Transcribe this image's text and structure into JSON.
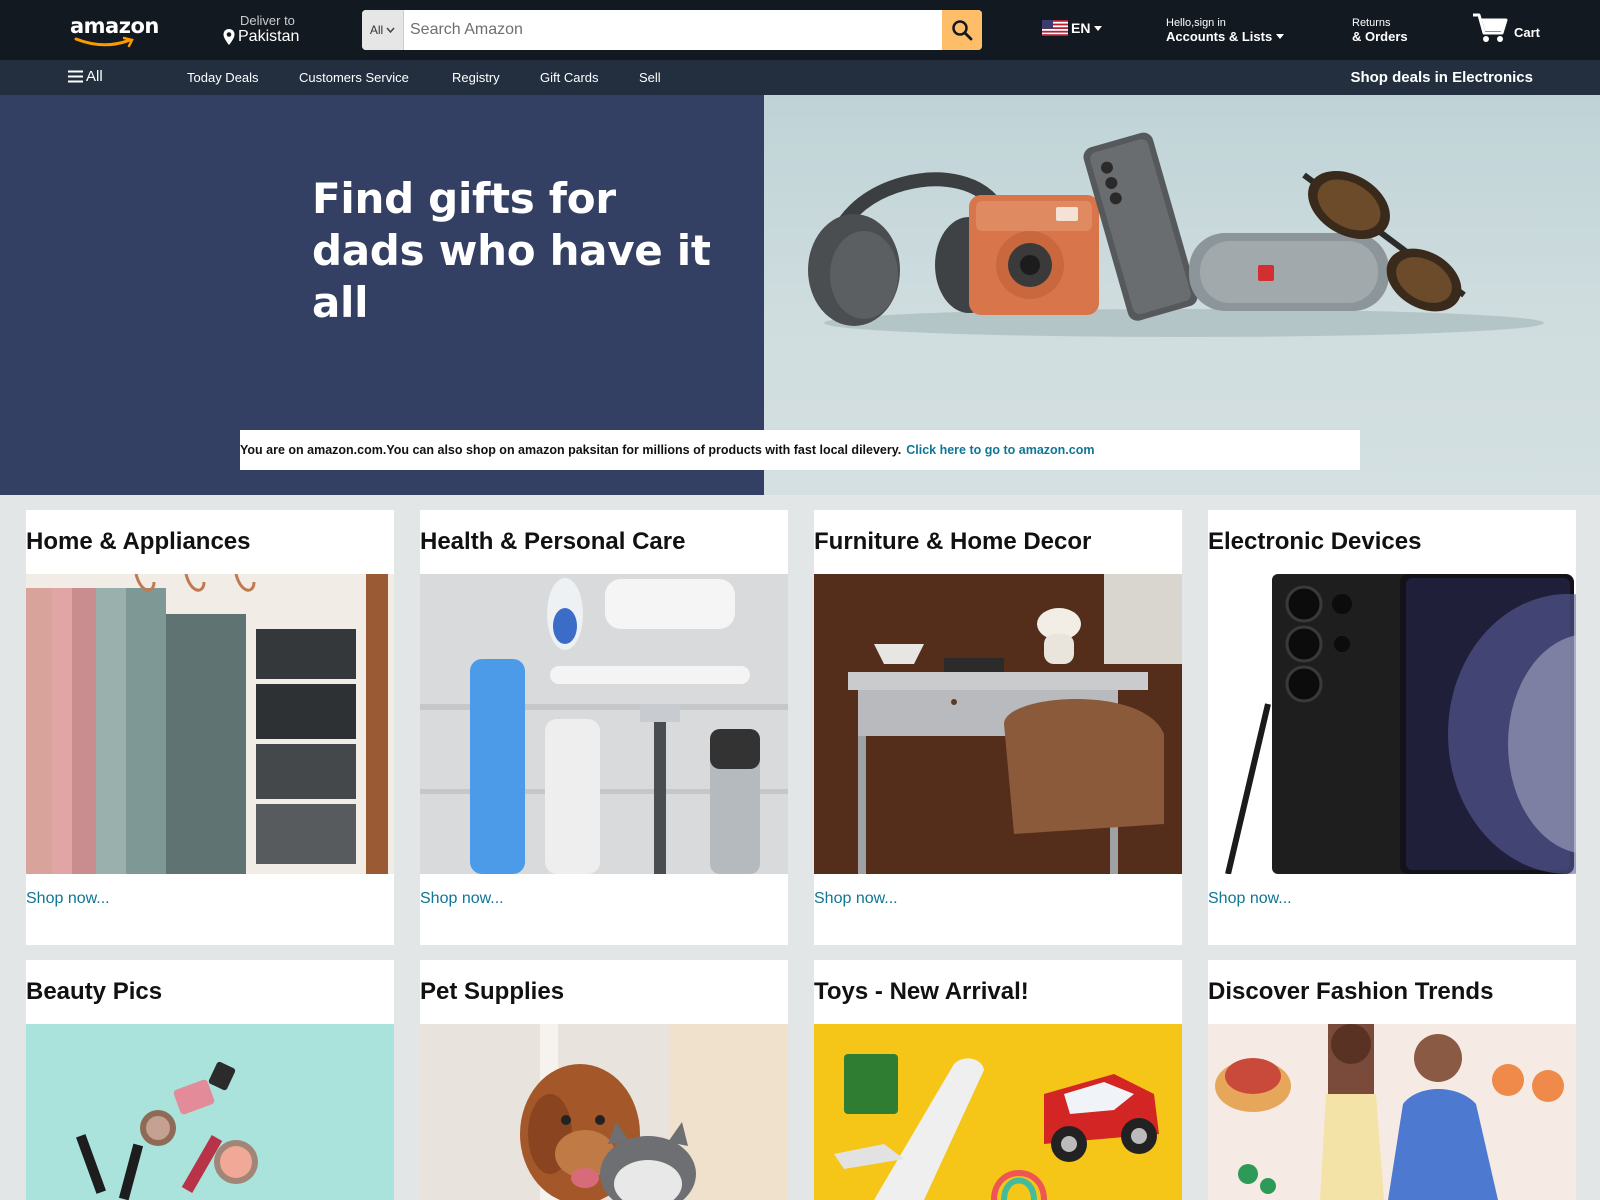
{
  "header": {
    "logo_text": "amazon",
    "deliver_label": "Deliver to",
    "deliver_location": "Pakistan",
    "search_category": "All",
    "search_placeholder": "Search Amazon",
    "language": "EN",
    "account_greeting": "Hello,sign in",
    "account_label": "Accounts & Lists",
    "returns_label": "Returns",
    "orders_label": "& Orders",
    "cart_label": "Cart"
  },
  "subnav": {
    "all_label": "All",
    "links": [
      "Today Deals",
      "Customers Service",
      "Registry",
      "Gift Cards",
      "Sell"
    ],
    "deals_label": "Shop deals in Electronics"
  },
  "hero": {
    "title_line1": "Find gifts for",
    "title_line2": "dads who have it all",
    "notice": "You are on amazon.com.You can also shop on amazon paksitan for millions of products with fast local dilevery.",
    "notice_link": "Click here to go to amazon.com"
  },
  "cards": [
    {
      "title": "Home & Appliances",
      "link": "Shop now..."
    },
    {
      "title": "Health & Personal Care",
      "link": "Shop now..."
    },
    {
      "title": "Furniture & Home Decor",
      "link": "Shop now..."
    },
    {
      "title": "Electronic Devices",
      "link": "Shop now..."
    },
    {
      "title": "Beauty Pics",
      "link": ""
    },
    {
      "title": "Pet Supplies",
      "link": ""
    },
    {
      "title": "Toys - New Arrival!",
      "link": ""
    },
    {
      "title": "Discover Fashion Trends",
      "link": ""
    }
  ],
  "colors": {
    "nav_top": "#131921",
    "nav_sub": "#232f3e",
    "search_button": "#febd69",
    "hero_left": "#333f63",
    "link": "#0f7694",
    "page_bg": "#e3e6e6"
  }
}
